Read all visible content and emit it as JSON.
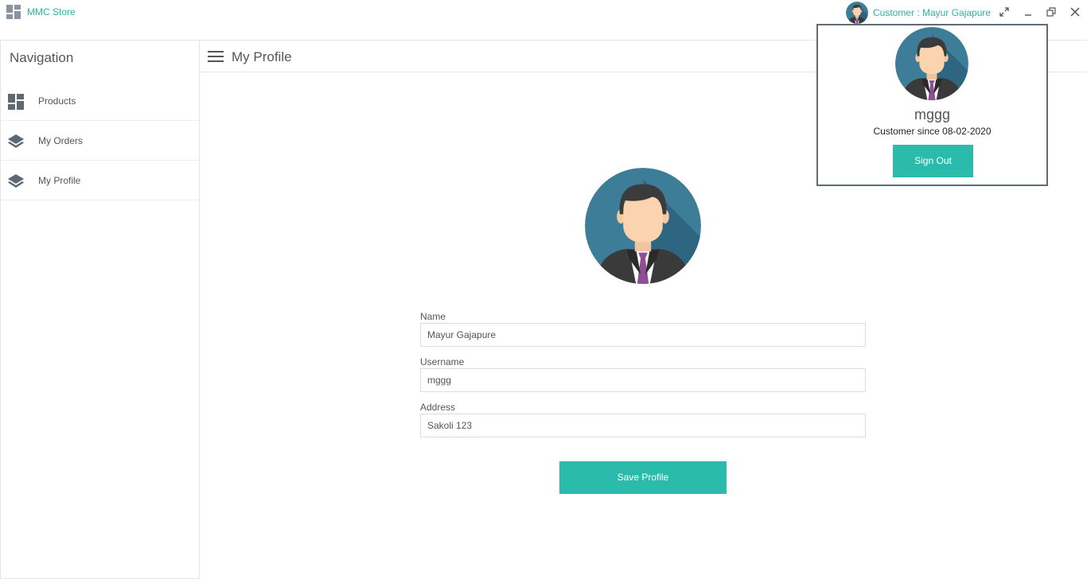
{
  "app": {
    "title": "MMC Store",
    "user_label": "Customer : Mayur Gajapure"
  },
  "sidebar": {
    "title": "Navigation",
    "items": [
      {
        "label": "Products",
        "icon": "dashboard-grid-icon"
      },
      {
        "label": "My Orders",
        "icon": "layers-icon"
      },
      {
        "label": "My Profile",
        "icon": "layers-icon"
      }
    ]
  },
  "main": {
    "title": "My Profile",
    "fields": [
      {
        "label": "Name",
        "value": "Mayur Gajapure"
      },
      {
        "label": "Username",
        "value": "mggg"
      },
      {
        "label": "Address",
        "value": "Sakoli 123"
      }
    ],
    "save_label": "Save Profile"
  },
  "popup": {
    "username": "mggg",
    "since": "Customer since 08-02-2020",
    "signout_label": "Sign Out"
  },
  "colors": {
    "accent": "#2bbbad",
    "accent_text": "#2bb3a7",
    "avatar_bg": "#3a7a95"
  }
}
